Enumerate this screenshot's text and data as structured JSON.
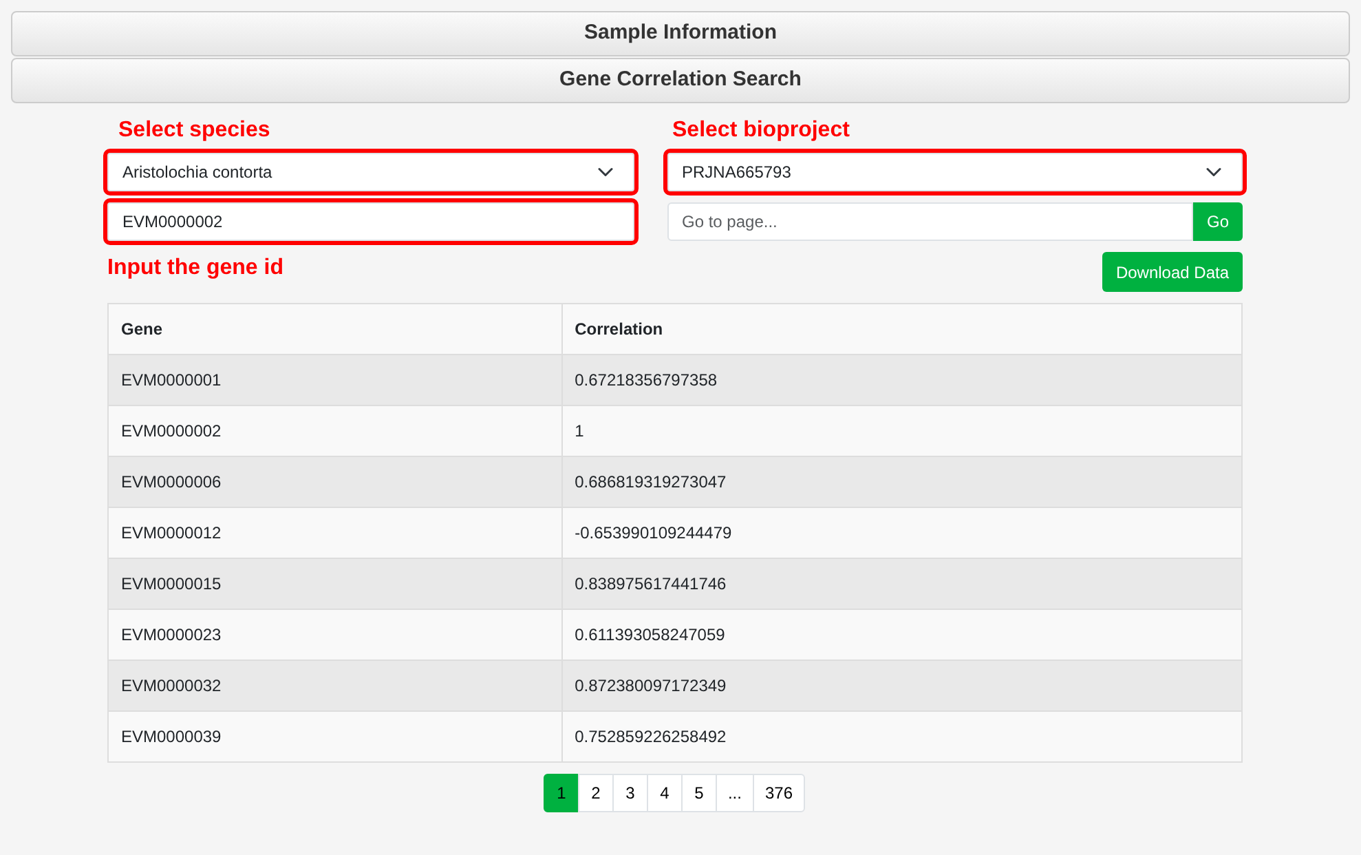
{
  "sections": [
    {
      "title": "Sample Information"
    },
    {
      "title": "Gene Correlation Search"
    }
  ],
  "species": {
    "annotation": "Select species",
    "value": "Aristolochia contorta",
    "highlighted": true
  },
  "bioproject": {
    "annotation": "Select bioproject",
    "value": "PRJNA665793",
    "highlighted": true
  },
  "gene_input": {
    "value": "EVM0000002",
    "annotation": "Input the gene id",
    "highlighted": true
  },
  "goto_page": {
    "placeholder": "Go to page...",
    "button": "Go"
  },
  "download_button": "Download Data",
  "table": {
    "columns": [
      "Gene",
      "Correlation"
    ],
    "rows": [
      [
        "EVM0000001",
        "0.67218356797358"
      ],
      [
        "EVM0000002",
        "1"
      ],
      [
        "EVM0000006",
        "0.686819319273047"
      ],
      [
        "EVM0000012",
        "-0.653990109244479"
      ],
      [
        "EVM0000015",
        "0.838975617441746"
      ],
      [
        "EVM0000023",
        "0.611393058247059"
      ],
      [
        "EVM0000032",
        "0.872380097172349"
      ],
      [
        "EVM0000039",
        "0.752859226258492"
      ]
    ]
  },
  "pagination": [
    {
      "label": "1",
      "selected": true
    },
    {
      "label": "2",
      "selected": false
    },
    {
      "label": "3",
      "selected": false
    },
    {
      "label": "4",
      "selected": false
    },
    {
      "label": "5",
      "selected": false
    },
    {
      "label": "...",
      "selected": false
    },
    {
      "label": "376",
      "selected": false
    }
  ]
}
